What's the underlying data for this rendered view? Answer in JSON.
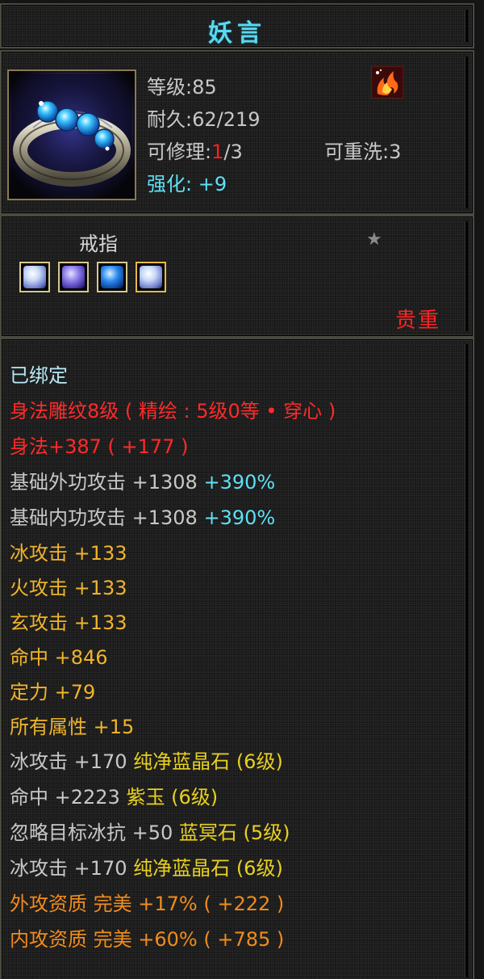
{
  "title": "妖言",
  "header": {
    "level_label": "等级:",
    "level_value": "85",
    "durability_label": "耐久:",
    "durability_value": "62/219",
    "repair_label": "可修理:",
    "repair_used": "1",
    "repair_total": "/3",
    "rewash_label": "可重洗:",
    "rewash_value": "3",
    "enhance_label": "强化:",
    "enhance_value": " +9",
    "item_icon": "silver-ring-with-blue-gems",
    "badge_icon": "flame-phoenix-icon"
  },
  "item_type": "戒指",
  "rarity": "贵重",
  "gems": [
    {
      "icon": "pale-crystal-gem",
      "color": "#c8d8f8"
    },
    {
      "icon": "violet-crystal-gem",
      "color": "#8878e8"
    },
    {
      "icon": "blue-crystal-gem",
      "color": "#2a88f0"
    },
    {
      "icon": "pale-crystal-gem-gold-frame",
      "color": "#c8d8f8"
    }
  ],
  "attributes": {
    "bound": "已绑定",
    "engrave": "身法雕纹8级 ( 精绘 : 5级0等 • 穿心 )",
    "agility_main": "身法+387",
    "agility_bonus": " ( +177 ) ",
    "ext_atk_label": "基础外功攻击  +1308 ",
    "ext_atk_pct": "+390%",
    "int_atk_label": "基础内功攻击  +1308 ",
    "int_atk_pct": "+390%",
    "ice_atk": "冰攻击  +133",
    "fire_atk": "火攻击  +133",
    "xuan_atk": "玄攻击  +133",
    "hit": "命中  +846",
    "focus": "定力  +79",
    "all_attr": "所有属性  +15",
    "gem1_stat": "冰攻击  +170 ",
    "gem1_name": "纯净蓝晶石 (6级)",
    "gem2_stat": "命中  +2223 ",
    "gem2_name": "紫玉 (6级)",
    "gem3_stat": "忽略目标冰抗  +50 ",
    "gem3_name": "蓝冥石 (5级)",
    "gem4_stat": "冰攻击  +170 ",
    "gem4_name": "纯净蓝晶石 (6级)",
    "ext_quality": "外攻资质    完美  +17%  ( +222 )",
    "int_quality": "内攻资质    完美  +60%  ( +785 )"
  }
}
